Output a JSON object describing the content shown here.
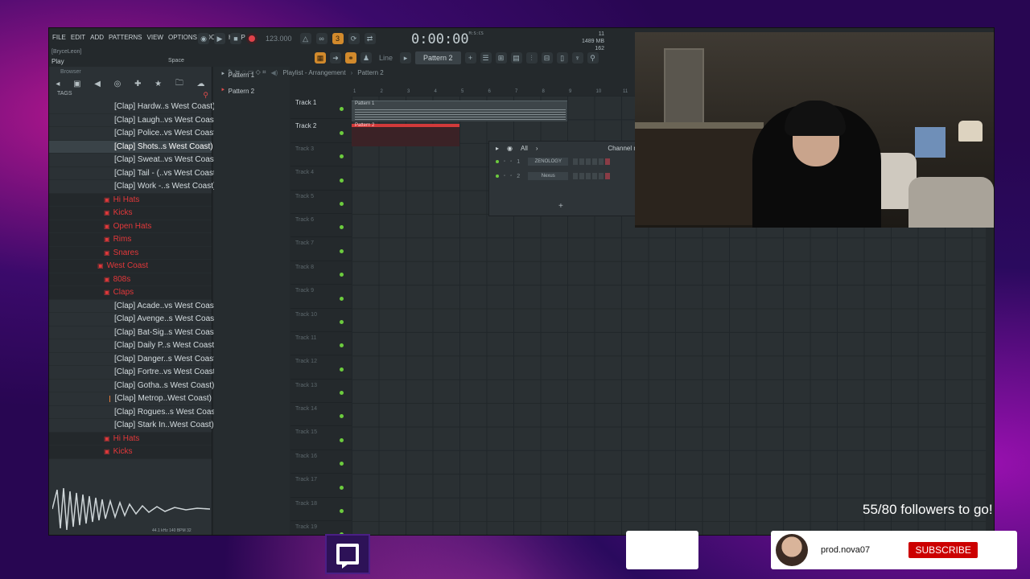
{
  "app": {
    "menu": [
      "FILE",
      "EDIT",
      "ADD",
      "PATTERNS",
      "VIEW",
      "OPTIONS",
      "TOOLS",
      "HELP"
    ],
    "user_hint": "[BryceLeon]",
    "hint_action": "Play",
    "hint_key": "Space",
    "tempo": "123.000",
    "time": "0:00:00",
    "time_unit": "M:S:CS",
    "memory": "1489 MB",
    "cpu_count": "11",
    "cpu_line2": "162",
    "pattern_selector": "Pattern 2",
    "snap": "Line"
  },
  "browser": {
    "title": "Browser",
    "tags_label": "TAGS",
    "items": [
      {
        "type": "file",
        "label": "[Clap] Hardw..s West Coast)"
      },
      {
        "type": "file",
        "label": "[Clap] Laugh..vs West Coast)"
      },
      {
        "type": "file",
        "label": "[Clap] Police..vs West Coast)"
      },
      {
        "type": "file",
        "label": "[Clap] Shots..s West Coast)",
        "selected": true
      },
      {
        "type": "file",
        "label": "[Clap] Sweat..vs West Coast)"
      },
      {
        "type": "file",
        "label": "[Clap] Tail - (..vs West Coast)"
      },
      {
        "type": "file",
        "label": "[Clap] Work -..s West Coast)"
      },
      {
        "type": "folder",
        "label": "Hi Hats"
      },
      {
        "type": "folder",
        "label": "Kicks"
      },
      {
        "type": "folder",
        "label": "Open Hats"
      },
      {
        "type": "folder",
        "label": "Rims"
      },
      {
        "type": "folder",
        "label": "Snares"
      },
      {
        "type": "folder",
        "label": "West Coast",
        "level": 1
      },
      {
        "type": "folder",
        "label": "808s"
      },
      {
        "type": "folder",
        "label": "Claps"
      },
      {
        "type": "file",
        "label": "[Clap] Acade..vs West Coast)"
      },
      {
        "type": "file",
        "label": "[Clap] Avenge..s West Coast)"
      },
      {
        "type": "file",
        "label": "[Clap] Bat-Sig..s West Coast)"
      },
      {
        "type": "file",
        "label": "[Clap] Daily P..s West Coast)"
      },
      {
        "type": "file",
        "label": "[Clap] Danger..s West Coast)"
      },
      {
        "type": "file",
        "label": "[Clap] Fortre..vs West Coast)"
      },
      {
        "type": "file",
        "label": "[Clap] Gotha..s West Coast)"
      },
      {
        "type": "file",
        "label": "[Clap] Metrop..West Coast)"
      },
      {
        "type": "file",
        "label": "[Clap] Rogues..s West Coast)"
      },
      {
        "type": "file",
        "label": "[Clap] Stark In..West Coast)"
      },
      {
        "type": "folder",
        "label": "Hi Hats"
      },
      {
        "type": "folder",
        "label": "Kicks"
      }
    ],
    "wave_info": "44.1 kHz 140 BPM 32"
  },
  "patterns": [
    "Pattern 1",
    "Pattern 2"
  ],
  "playlist": {
    "breadcrumb": [
      "Playlist - Arrangement",
      "Pattern 2"
    ],
    "ruler": [
      "1",
      "2",
      "3",
      "4",
      "5",
      "6",
      "7",
      "8",
      "9",
      "10",
      "11"
    ],
    "tracks": [
      "Track 1",
      "Track 2",
      "Track 3",
      "Track 4",
      "Track 5",
      "Track 6",
      "Track 7",
      "Track 8",
      "Track 9",
      "Track 10",
      "Track 11",
      "Track 12",
      "Track 13",
      "Track 14",
      "Track 15",
      "Track 16",
      "Track 17",
      "Track 18",
      "Track 19"
    ],
    "clips": [
      "Pattern 1",
      "Pattern 2"
    ]
  },
  "channel_rack": {
    "filter": "All",
    "title": "Channel r",
    "channels": [
      {
        "num": "1",
        "name": "ZENOLOGY"
      },
      {
        "num": "2",
        "name": "Nexus"
      }
    ]
  },
  "overlay": {
    "followers": "55/80 followers to go!",
    "username": "prod.nova07",
    "subscribe": "SUBSCRIBE"
  },
  "colors": {
    "accent_red": "#d23a3a",
    "accent_orange": "#d28a2c",
    "led_green": "#6ccb3e",
    "subscribe_red": "#cc0000"
  }
}
